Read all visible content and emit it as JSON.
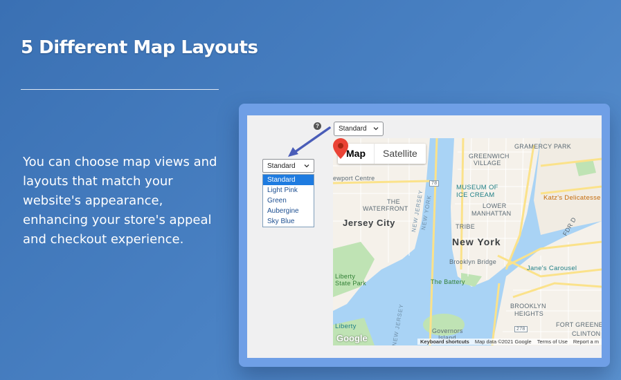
{
  "heading": {
    "title": "5 Different Map Layouts"
  },
  "description": "You can choose map views and layouts that match your website's appearance, enhancing your store's appeal and checkout experience.",
  "screenshot": {
    "help_icon": "?",
    "top_select": {
      "value": "Standard"
    },
    "layout_select": {
      "value": "Standard",
      "options": [
        "Standard",
        "Light Pink",
        "Green",
        "Aubergine",
        "Sky Blue"
      ],
      "selected_index": 0
    },
    "map": {
      "tabs": {
        "map": "Map",
        "satellite": "Satellite"
      },
      "labels": {
        "gramercy": "GRAMERCY PARK",
        "greenwich": "GREENWICH",
        "village": "VILLAGE",
        "port": "ewport Centre",
        "museum_1": "MUSEUM OF",
        "museum_2": "ICE CREAM",
        "katz": "Katz's Delicatesse",
        "the": "THE",
        "waterfront": "WATERFRONT",
        "lower": "LOWER",
        "manhattan": "MANHATTAN",
        "jersey_city": "Jersey City",
        "tribeca": "TRIBE",
        "new_york": "New York",
        "fdr": "FDR D",
        "brooklyn_bridge": "Brooklyn Bridge",
        "janes": "Jane's Carousel",
        "liberty_state_1": "Liberty",
        "liberty_state_2": "State Park",
        "the_battery": "The Battery",
        "brooklyn_1": "BROOKLYN",
        "brooklyn_2": "HEIGHTS",
        "fort_greene_1": "FORT GREENE",
        "clinton": "CLINTON",
        "liberty_island": "Liberty",
        "governors_1": "Governors",
        "governors_2": "Island",
        "new_jersey_1": "NEW JERSEY",
        "new_york_water": "NEW YORK",
        "new_jersey_2": "NEW JERSEY",
        "route_78": "78",
        "route_278": "278"
      },
      "footer": {
        "shortcuts": "Keyboard shortcuts",
        "map_data": "Map data ©2021 Google",
        "terms": "Terms of Use",
        "report": "Report a m"
      },
      "logo": "Google"
    }
  },
  "colors": {
    "background": "#4a82c4",
    "card": "#6f9fe6",
    "arrow": "#4a5db8",
    "pin": "#ea4335",
    "water": "#a9d3f5",
    "land": "#f5f1ea",
    "park": "#bfe3b4",
    "road": "#fbe28a"
  }
}
